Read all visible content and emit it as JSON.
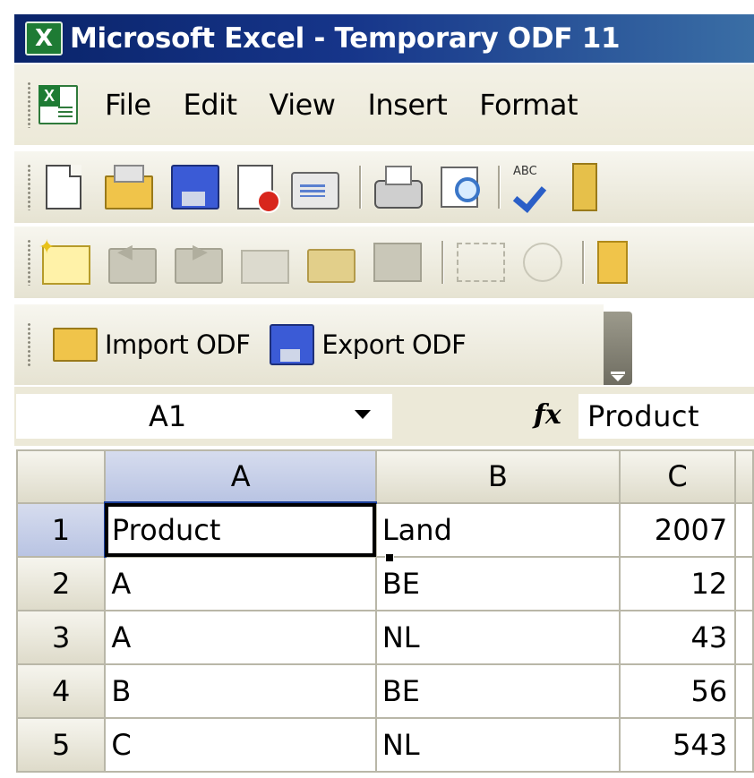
{
  "window": {
    "title": "Microsoft Excel - Temporary ODF 11",
    "app_icon": "excel-app-icon"
  },
  "menubar": {
    "doc_icon": "excel-document-icon",
    "items": [
      {
        "label": "File"
      },
      {
        "label": "Edit"
      },
      {
        "label": "View"
      },
      {
        "label": "Insert"
      },
      {
        "label": "Format"
      }
    ]
  },
  "standard_toolbar": {
    "buttons": [
      "new-icon",
      "open-icon",
      "save-icon",
      "permission-icon",
      "email-icon",
      "print-icon",
      "print-preview-icon",
      "spelling-icon",
      "research-icon"
    ]
  },
  "reviewing_toolbar": {
    "buttons": [
      "new-comment-icon",
      "previous-comment-icon",
      "next-comment-icon",
      "show-comment-icon",
      "show-all-comments-icon",
      "delete-comment-icon",
      "ink-annotations-icon",
      "delete-ink-icon",
      "reviewing-pane-icon"
    ]
  },
  "odf_toolbar": {
    "import_label": "Import ODF",
    "export_label": "Export ODF"
  },
  "formula_bar": {
    "name_box": "A1",
    "fx_symbol": "fx",
    "formula": "Product"
  },
  "sheet": {
    "columns": [
      "A",
      "B",
      "C"
    ],
    "active_cell": "A1",
    "rows": [
      {
        "num": "1",
        "cells": [
          "Product",
          "Land",
          "2007"
        ]
      },
      {
        "num": "2",
        "cells": [
          "A",
          "BE",
          "12"
        ]
      },
      {
        "num": "3",
        "cells": [
          "A",
          "NL",
          "43"
        ]
      },
      {
        "num": "4",
        "cells": [
          "B",
          "BE",
          "56"
        ]
      },
      {
        "num": "5",
        "cells": [
          "C",
          "NL",
          "543"
        ]
      }
    ]
  },
  "colors": {
    "title_bar": "#0a246a",
    "chrome": "#ece9d8",
    "selection_header": "#b9c4e3",
    "excel_green": "#1e7b34"
  }
}
